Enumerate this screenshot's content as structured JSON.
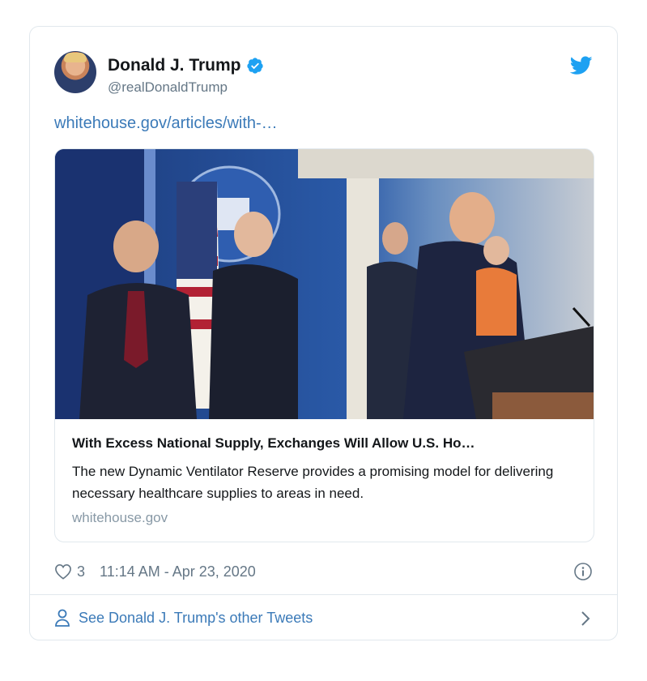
{
  "tweet": {
    "author": {
      "display_name": "Donald J. Trump",
      "handle": "@realDonaldTrump",
      "verified": true
    },
    "link_text": "whitehouse.gov/articles/with-…",
    "card": {
      "title": "With Excess National Supply, Exchanges Will Allow U.S. Ho…",
      "description": "The new Dynamic Ventilator Reserve provides a promising model for delivering necessary healthcare supplies to areas in need.",
      "domain": "whitehouse.gov"
    },
    "likes": "3",
    "timestamp": "11:14 AM - Apr 23, 2020",
    "footer_link": "See Donald J. Trump's other Tweets"
  },
  "colors": {
    "twitter_blue": "#1da1f2",
    "link_blue": "#3b7ab8",
    "secondary_text": "#657786",
    "border": "#e1e8ed"
  },
  "icons": [
    "verified-badge-icon",
    "twitter-bird-icon",
    "heart-icon",
    "info-icon",
    "person-icon",
    "chevron-right-icon"
  ]
}
